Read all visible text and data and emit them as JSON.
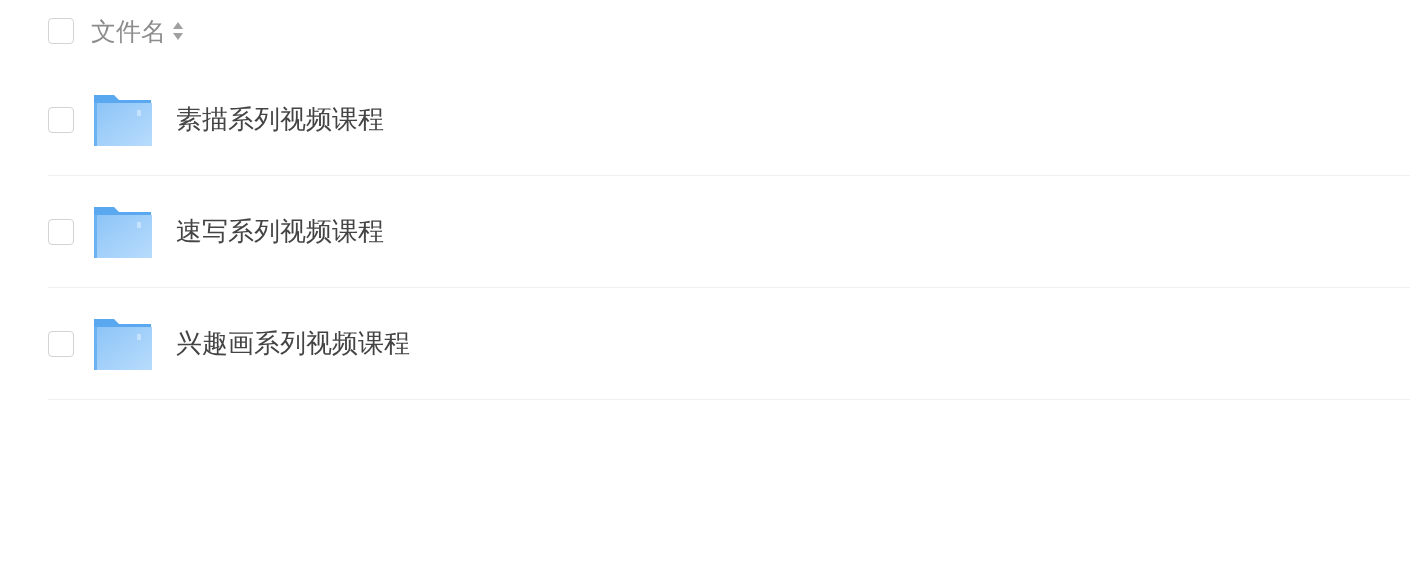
{
  "header": {
    "checked": false,
    "label": "文件名"
  },
  "rows": [
    {
      "name": "素描系列视频课程",
      "kind": "folder",
      "checked": false
    },
    {
      "name": "速写系列视频课程",
      "kind": "folder",
      "checked": false
    },
    {
      "name": "兴趣画系列视频课程",
      "kind": "folder",
      "checked": false
    }
  ]
}
